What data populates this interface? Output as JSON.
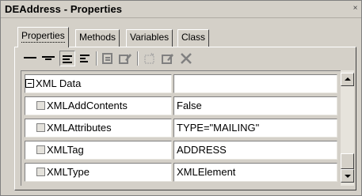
{
  "window": {
    "title": "DEAddress - Properties",
    "close_glyph": "×"
  },
  "tabs": [
    {
      "label": "Properties",
      "active": true
    },
    {
      "label": "Methods",
      "active": false
    },
    {
      "label": "Variables",
      "active": false
    },
    {
      "label": "Class",
      "active": false
    }
  ],
  "toolbar": {
    "items": [
      {
        "icon": "align-long-dash-icon",
        "enabled": true,
        "pressed": false
      },
      {
        "icon": "align-short-dash-icon",
        "enabled": true,
        "pressed": false
      },
      {
        "icon": "categorized-view-icon",
        "enabled": true,
        "pressed": true
      },
      {
        "icon": "alphabetic-view-icon",
        "enabled": true,
        "pressed": false
      },
      {
        "icon": "property-pages-icon",
        "enabled": false,
        "pressed": false
      },
      {
        "icon": "edit-properties-icon",
        "enabled": false,
        "pressed": false
      },
      {
        "icon": "new-item-icon",
        "enabled": false,
        "pressed": false
      },
      {
        "icon": "edit-item-icon",
        "enabled": false,
        "pressed": false
      },
      {
        "icon": "delete-icon",
        "enabled": false,
        "pressed": false
      }
    ]
  },
  "grid": {
    "group": {
      "name": "XML Data",
      "value": "",
      "expanded": true
    },
    "rows": [
      {
        "name": "XMLAddContents",
        "value": "False"
      },
      {
        "name": "XMLAttributes",
        "value": "TYPE=\"MAILING\""
      },
      {
        "name": "XMLTag",
        "value": "ADDRESS"
      },
      {
        "name": "XMLType",
        "value": "XMLElement"
      }
    ]
  },
  "scroll": {
    "position_fraction": 1.0
  }
}
